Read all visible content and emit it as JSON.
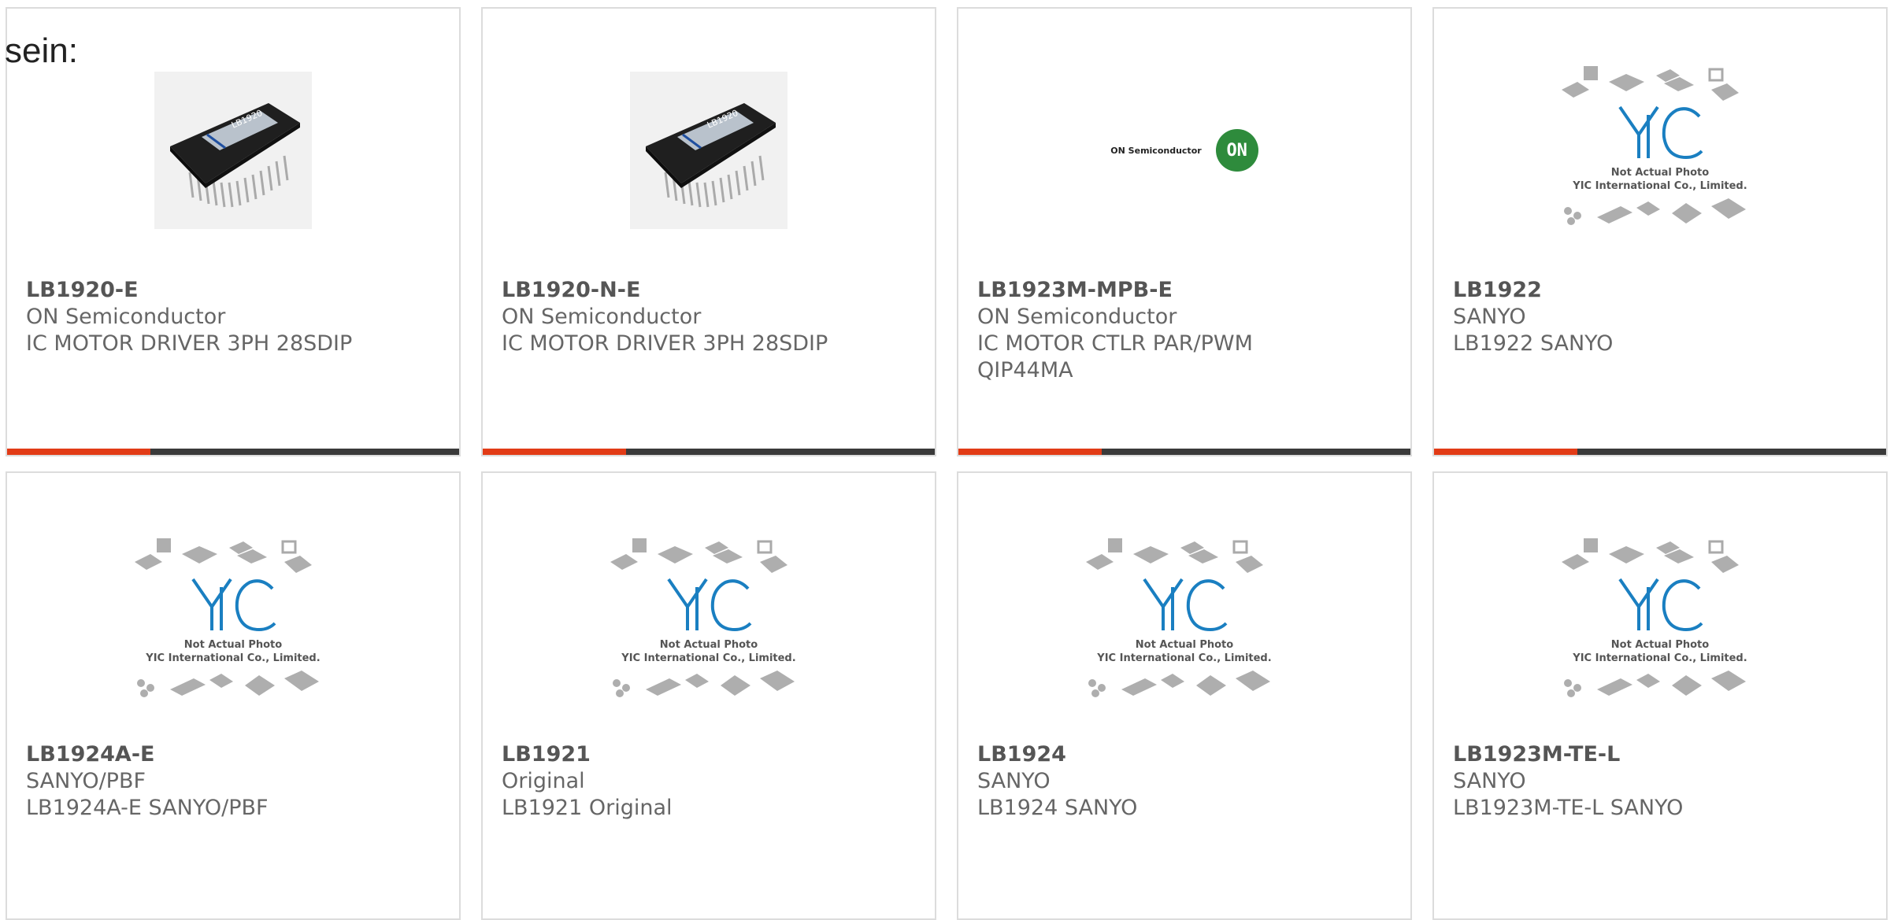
{
  "intro_text": "sein:",
  "colors": {
    "accent": "#e23b16",
    "bar": "#3a3a3a",
    "yic_blue": "#1a7fc1",
    "on_green": "#2e8b3c"
  },
  "placeholder": {
    "line1": "Not Actual Photo",
    "line2": "YIC International Co., Limited.",
    "logo": "YIC"
  },
  "on_logo": {
    "word": "ON Semiconductor",
    "badge": "ON"
  },
  "products": [
    {
      "part": "LB1920-E",
      "manufacturer": "ON Semiconductor",
      "description": "IC MOTOR DRIVER 3PH 28SDIP",
      "image": "chip-photo",
      "chip_label": "LB1920"
    },
    {
      "part": "LB1920-N-E",
      "manufacturer": "ON Semiconductor",
      "description": "IC MOTOR DRIVER 3PH 28SDIP",
      "image": "chip-photo",
      "chip_label": "LB1920"
    },
    {
      "part": "LB1923M-MPB-E",
      "manufacturer": "ON Semiconductor",
      "description": "IC MOTOR CTLR PAR/PWM QIP44MA",
      "image": "on-logo"
    },
    {
      "part": "LB1922",
      "manufacturer": "SANYO",
      "description": "LB1922 SANYO",
      "image": "placeholder"
    },
    {
      "part": "LB1924A-E",
      "manufacturer": "SANYO/PBF",
      "description": "LB1924A-E SANYO/PBF",
      "image": "placeholder"
    },
    {
      "part": "LB1921",
      "manufacturer": "Original",
      "description": "LB1921 Original",
      "image": "placeholder"
    },
    {
      "part": "LB1924",
      "manufacturer": "SANYO",
      "description": "LB1924 SANYO",
      "image": "placeholder"
    },
    {
      "part": "LB1923M-TE-L",
      "manufacturer": "SANYO",
      "description": "LB1923M-TE-L SANYO",
      "image": "placeholder"
    }
  ]
}
